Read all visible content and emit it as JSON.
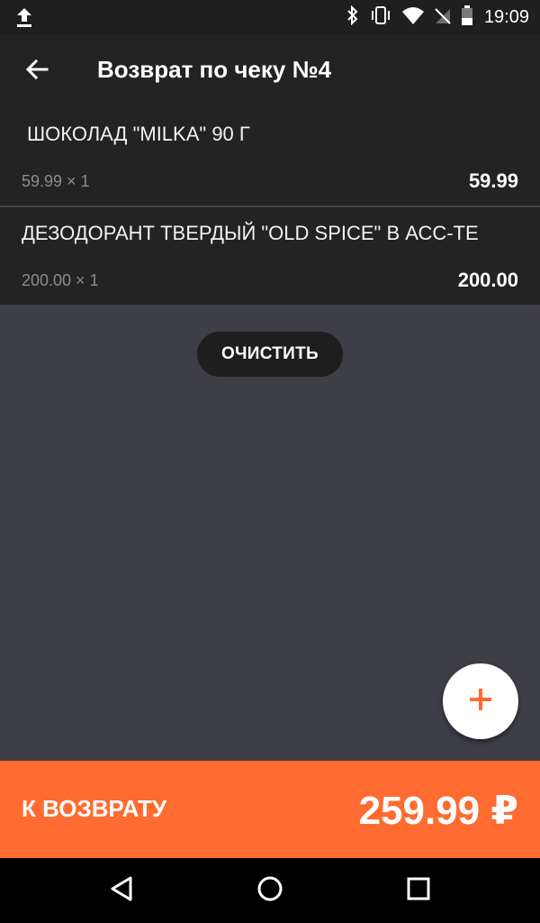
{
  "status_bar": {
    "time": "19:09",
    "icons": [
      "upload-icon",
      "bluetooth-icon",
      "vibrate-icon",
      "wifi-icon",
      "no-signal-icon",
      "battery-icon"
    ]
  },
  "app_bar": {
    "title": "Возврат по чеку №4",
    "back_icon": "arrow-left-icon"
  },
  "items": [
    {
      "name": "ШОКОЛАД \"MILKA\"  90 Г",
      "qty_line": "59.99 × 1",
      "total": "59.99"
    },
    {
      "name": "ДЕЗОДОРАНТ ТВЕРДЫЙ \"OLD SPICE\" В АСС-ТЕ",
      "qty_line": "200.00 × 1",
      "total": "200.00"
    }
  ],
  "actions": {
    "clear_label": "ОЧИСТИТЬ",
    "add_icon": "plus-icon"
  },
  "footer": {
    "label": "К ВОЗВРАТУ",
    "amount": "259.99 ₽"
  },
  "nav_bar": {
    "icons": [
      "back-triangle-icon",
      "home-circle-icon",
      "recents-square-icon"
    ]
  },
  "colors": {
    "accent": "#ff6b30",
    "background": "#3e3e47",
    "surface": "#232323"
  }
}
